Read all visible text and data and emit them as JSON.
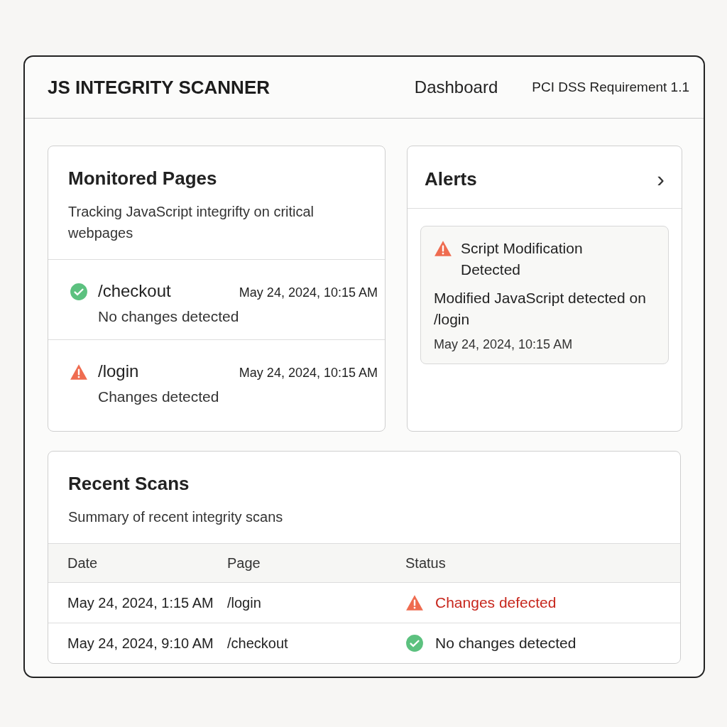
{
  "header": {
    "title": "JS INTEGRITY SCANNER",
    "nav": "Dashboard",
    "requirement": "PCI DSS Requirement 1.1"
  },
  "monitored": {
    "title": "Monitored Pages",
    "subtitle": "Tracking JavaScript integrifty on critical webpages",
    "pages": [
      {
        "path": "/checkout",
        "time": "May 24, 2024, 10:15 AM",
        "status": "No changes detected",
        "kind": "ok"
      },
      {
        "path": "/login",
        "time": "May 24, 2024, 10:15 AM",
        "status": "Changes detected",
        "kind": "changed"
      }
    ]
  },
  "alerts": {
    "title": "Alerts",
    "chevron": "›",
    "items": [
      {
        "title": "Script Modification Detected",
        "message": "Modified JavaScript detected on /login",
        "time": "May 24, 2024, 10:15 AM"
      }
    ]
  },
  "scans": {
    "title": "Recent Scans",
    "subtitle": "Summary of recent integrity scans",
    "columns": [
      "Date",
      "Page",
      "Status"
    ],
    "rows": [
      {
        "date": "May 24, 2024, 1:15 AM",
        "page": "/login",
        "status": "Changes defected",
        "kind": "changed"
      },
      {
        "date": "May 24, 2024, 9:10 AM",
        "page": "/checkout",
        "status": "No changes detected",
        "kind": "ok"
      }
    ]
  }
}
